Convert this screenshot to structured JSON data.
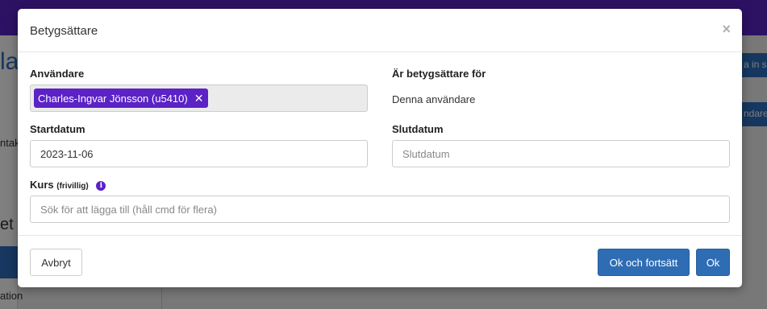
{
  "background": {
    "sidebar_title": "la",
    "sidebar_text_1": "ntak",
    "sidebar_text_2": "et",
    "sidebar_text_3": "ation",
    "right_button_1": "a in s",
    "right_button_2": "ndare"
  },
  "modal": {
    "title": "Betygsättare",
    "close_symbol": "×",
    "user_field": {
      "label": "Användare",
      "tag_text": "Charles-Ingvar Jönsson (u5410)",
      "tag_remove_symbol": "✕"
    },
    "grader_for": {
      "label": "Är betygsättare för",
      "value": "Denna användare"
    },
    "start_date": {
      "label": "Startdatum",
      "value": "2023-11-06"
    },
    "end_date": {
      "label": "Slutdatum",
      "placeholder": "Slutdatum"
    },
    "course": {
      "label": "Kurs",
      "label_note": "(frivillig)",
      "info_symbol": "i",
      "placeholder": "Sök för att lägga till (håll cmd för flera)"
    },
    "footer": {
      "cancel_label": "Avbryt",
      "ok_continue_label": "Ok och fortsätt",
      "ok_label": "Ok"
    }
  },
  "colors": {
    "brand_purple": "#5b22c6",
    "primary_blue": "#2e6db4"
  }
}
